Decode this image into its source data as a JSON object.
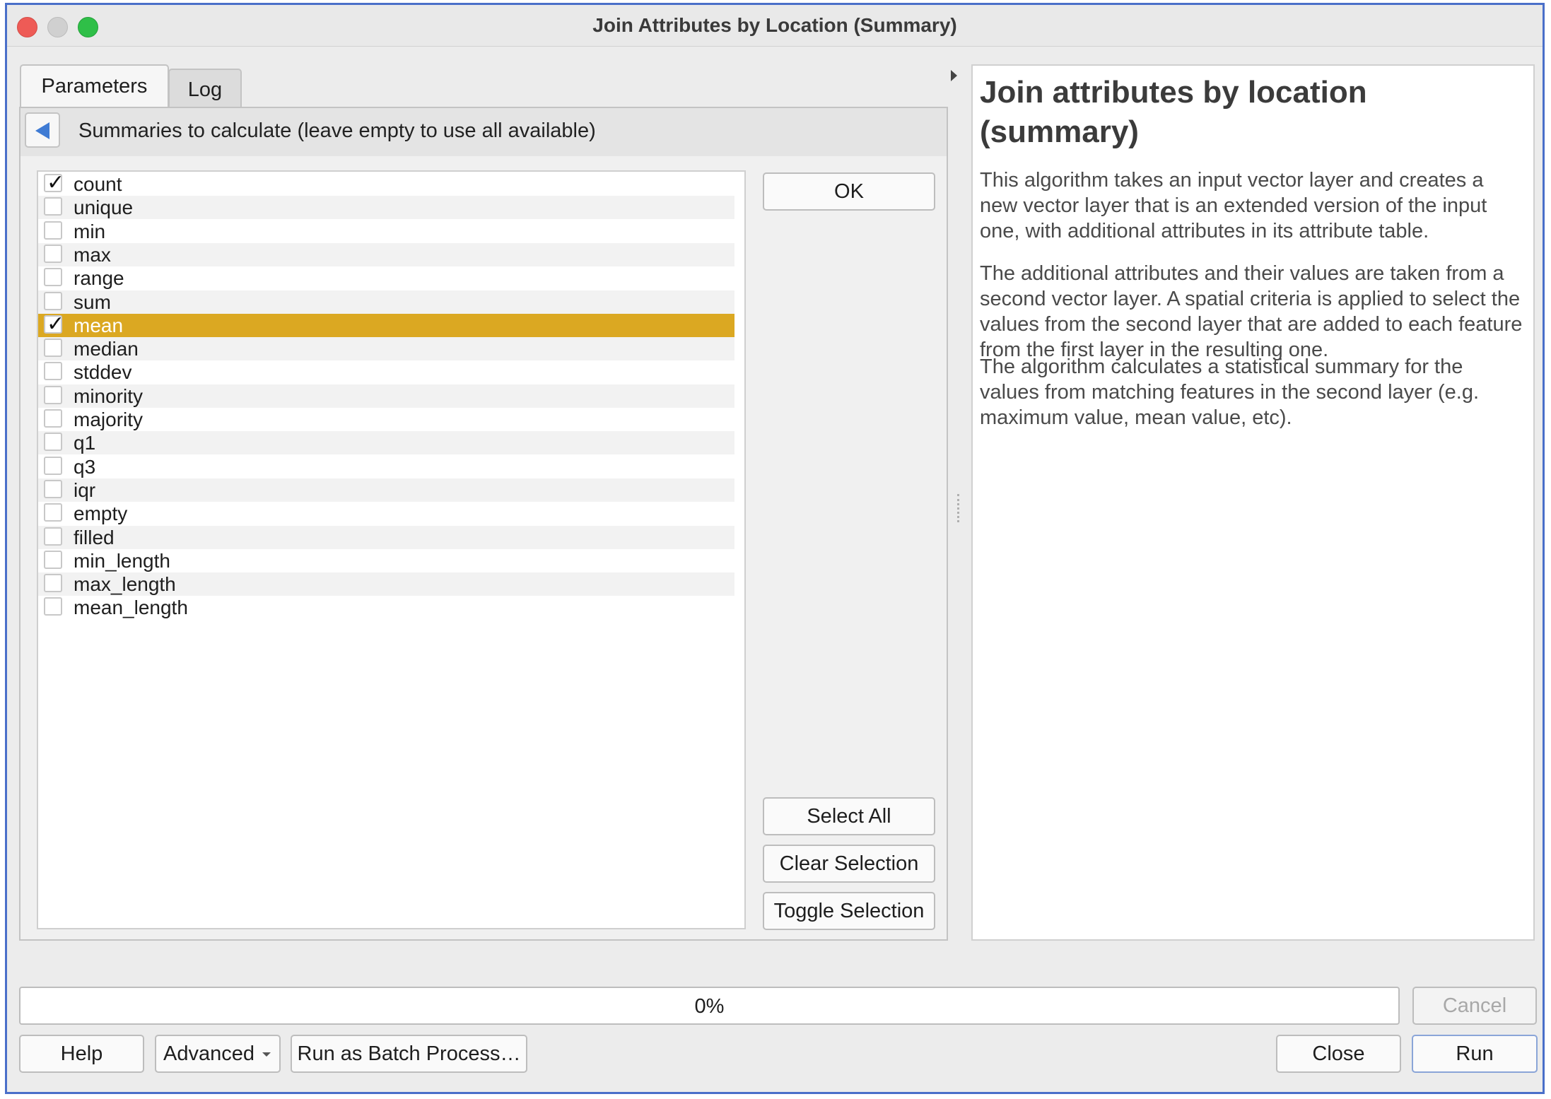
{
  "window": {
    "title": "Join Attributes by Location (Summary)"
  },
  "tabs": [
    {
      "label": "Parameters"
    },
    {
      "label": "Log"
    }
  ],
  "summaries": {
    "header": "Summaries to calculate (leave empty to use all available)",
    "items": [
      {
        "label": "count",
        "checked": true
      },
      {
        "label": "unique",
        "checked": false
      },
      {
        "label": "min",
        "checked": false
      },
      {
        "label": "max",
        "checked": false
      },
      {
        "label": "range",
        "checked": false
      },
      {
        "label": "sum",
        "checked": false
      },
      {
        "label": "mean",
        "checked": true,
        "selected": true
      },
      {
        "label": "median",
        "checked": false
      },
      {
        "label": "stddev",
        "checked": false
      },
      {
        "label": "minority",
        "checked": false
      },
      {
        "label": "majority",
        "checked": false
      },
      {
        "label": "q1",
        "checked": false
      },
      {
        "label": "q3",
        "checked": false
      },
      {
        "label": "iqr",
        "checked": false
      },
      {
        "label": "empty",
        "checked": false
      },
      {
        "label": "filled",
        "checked": false
      },
      {
        "label": "min_length",
        "checked": false
      },
      {
        "label": "max_length",
        "checked": false
      },
      {
        "label": "mean_length",
        "checked": false
      }
    ],
    "check_glyph": "✓",
    "selection_color": "#dba822"
  },
  "side_buttons": {
    "ok": "OK",
    "select_all": "Select All",
    "clear_selection": "Clear Selection",
    "toggle_selection": "Toggle Selection"
  },
  "help": {
    "title": "Join attributes by location (summary)",
    "paragraphs": [
      "This algorithm takes an input vector layer and creates a new vector layer that is an extended version of the input one, with additional attributes in its attribute table.",
      "The additional attributes and their values are taken from a second vector layer. A spatial criteria is applied to select the values from the second layer that are added to each feature from the first layer in the resulting one.",
      "The algorithm calculates a statistical summary for the values from matching features in the second layer (e.g. maximum value, mean value, etc)."
    ]
  },
  "progress": {
    "value": 0,
    "label": "0%"
  },
  "footer": {
    "cancel": "Cancel",
    "help": "Help",
    "advanced": "Advanced",
    "batch": "Run as Batch Process…",
    "close": "Close",
    "run": "Run"
  }
}
